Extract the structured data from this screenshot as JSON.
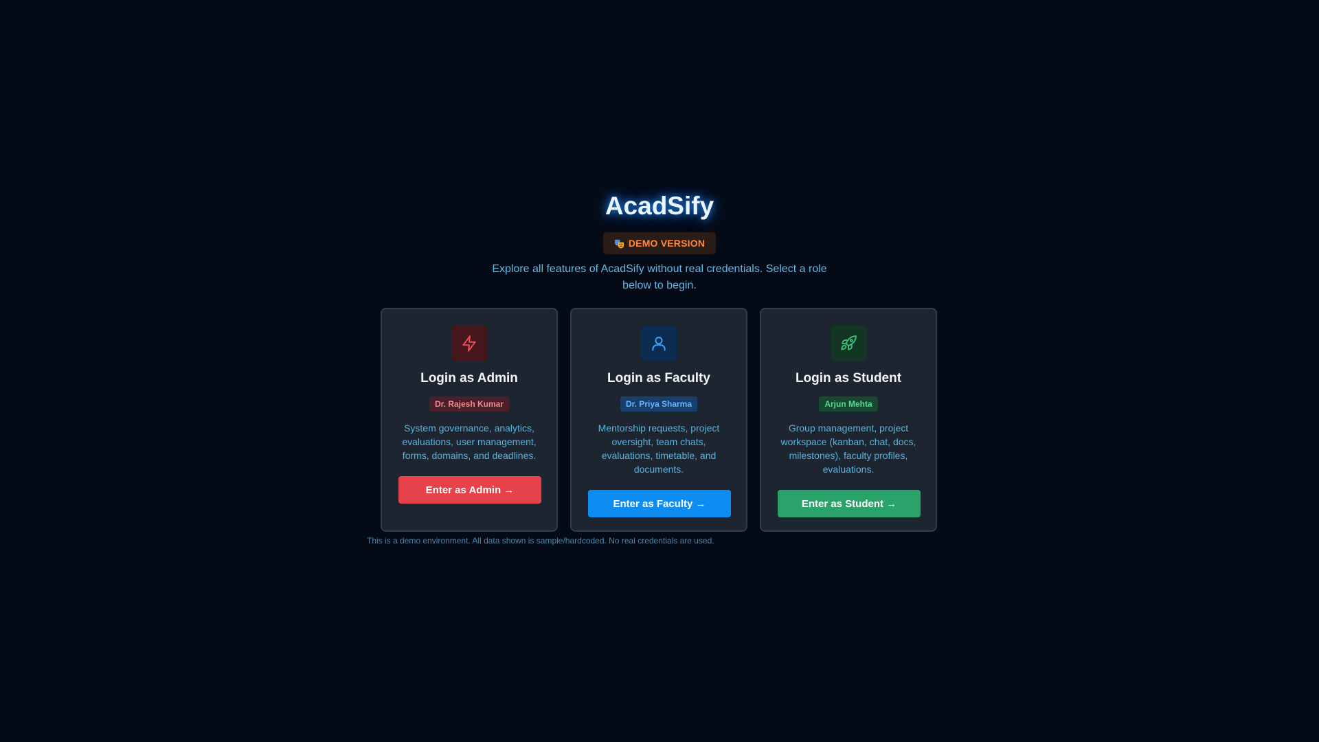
{
  "app": {
    "title": "AcadSify",
    "demo_badge": "DEMO VERSION",
    "subtitle": "Explore all features of AcadSify without real credentials. Select a role below to begin."
  },
  "roles": [
    {
      "key": "admin",
      "icon": "lightning-bolt-icon",
      "title": "Login as Admin",
      "user": "Dr. Rajesh Kumar",
      "description": "System governance, analytics, evaluations, user management, forms, domains, and deadlines.",
      "button": "Enter as Admin →",
      "accent": "#e5424b"
    },
    {
      "key": "faculty",
      "icon": "user-icon",
      "title": "Login as Faculty",
      "user": "Dr. Priya Sharma",
      "description": "Mentorship requests, project oversight, team chats, evaluations, timetable, and documents.",
      "button": "Enter as Faculty →",
      "accent": "#0d8df2"
    },
    {
      "key": "student",
      "icon": "rocket-icon",
      "title": "Login as Student",
      "user": "Arjun Mehta",
      "description": "Group management, project workspace (kanban, chat, docs, milestones), faculty profiles, evaluations.",
      "button": "Enter as Student →",
      "accent": "#2aa36a"
    }
  ],
  "footer": {
    "note": "This is a demo environment. All data shown is sample/hardcoded. No real credentials are used."
  }
}
